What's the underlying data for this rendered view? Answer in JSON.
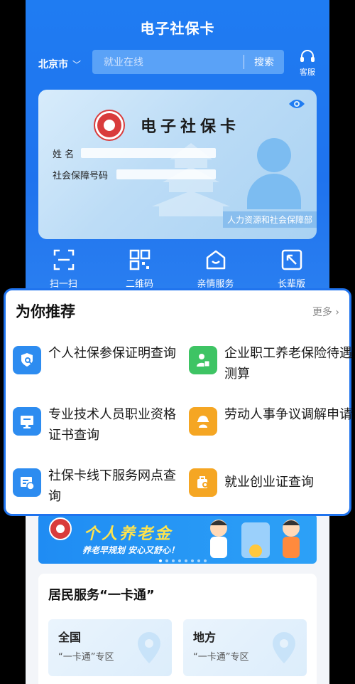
{
  "header": {
    "title": "电子社保卡",
    "city": "北京市",
    "search_placeholder": "就业在线",
    "search_button": "搜索",
    "customer_service": "客服"
  },
  "card": {
    "title": "电子社保卡",
    "name_label": "姓  名",
    "id_label": "社会保障号码",
    "issuer": "人力资源和社会保障部"
  },
  "shortcuts": [
    "扫一扫",
    "二维码",
    "亲情服务",
    "长辈版"
  ],
  "recommend": {
    "title": "为你推荐",
    "more": "更多",
    "items": [
      {
        "label": "个人社保参保证明查询",
        "color": "#2d8cf0",
        "icon": "document-search-icon"
      },
      {
        "label": "企业职工养老保险待遇测算",
        "color": "#3ec464",
        "icon": "person-calculator-icon"
      },
      {
        "label": "专业技术人员职业资格证书查询",
        "color": "#2d8cf0",
        "icon": "certificate-monitor-icon"
      },
      {
        "label": "劳动人事争议调解申请",
        "color": "#f5a623",
        "icon": "worker-helmet-icon"
      },
      {
        "label": "社保卡线下服务网点查询",
        "color": "#2d8cf0",
        "icon": "service-outlet-icon"
      },
      {
        "label": "就业创业证查询",
        "color": "#f5a623",
        "icon": "briefcase-search-icon"
      }
    ]
  },
  "banner": {
    "title": "个人养老金",
    "subtitle": "养老早规划 安心又舒心！"
  },
  "resident": {
    "title": "居民服务“一卡通”",
    "tiles": [
      {
        "title": "全国",
        "subtitle": "“一卡通”专区"
      },
      {
        "title": "地方",
        "subtitle": "“一卡通”专区"
      }
    ]
  }
}
